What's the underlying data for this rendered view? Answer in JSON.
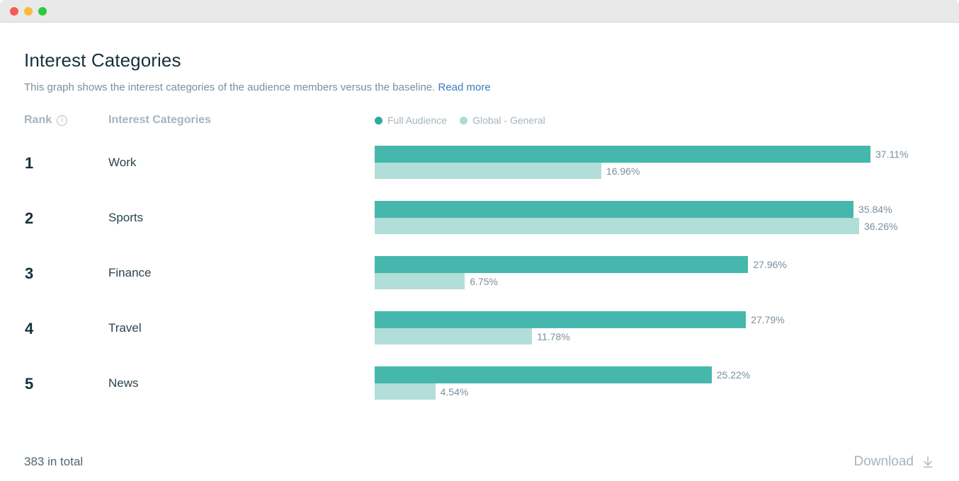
{
  "window": {
    "traffic_lights": [
      {
        "name": "close",
        "color": "#f85b53"
      },
      {
        "name": "minimize",
        "color": "#f7bb3f"
      },
      {
        "name": "maximize",
        "color": "#2ec93f"
      }
    ]
  },
  "header": {
    "title": "Interest Categories",
    "description": "This graph shows the interest categories of the audience members versus the baseline.",
    "read_more_label": "Read more"
  },
  "table_header": {
    "rank_label": "Rank",
    "rank_info_icon": "info-icon",
    "category_label": "Interest Categories"
  },
  "legend": {
    "items": [
      {
        "label": "Full Audience",
        "color": "#31a99e"
      },
      {
        "label": "Global - General",
        "color": "#a8dcd6"
      }
    ]
  },
  "footer": {
    "total_label": "383 in total",
    "download_label": "Download",
    "download_icon": "download-arrow-icon"
  },
  "colors": {
    "primary_bar": "#46b7ac",
    "secondary_bar": "#b2ded9",
    "title": "#16313d",
    "muted": "#7b8f9c",
    "link": "#3b7bbf"
  },
  "chart_data": {
    "type": "bar",
    "title": "Interest Categories",
    "subtitle": "This graph shows the interest categories of the audience members versus the baseline.",
    "orientation": "horizontal",
    "grid": false,
    "legend_position": "top-right",
    "xlabel": "",
    "ylabel": "",
    "xlim": [
      0,
      37.11
    ],
    "units": "percent",
    "max_value": 37.11,
    "categories": [
      "Work",
      "Sports",
      "Finance",
      "Travel",
      "News"
    ],
    "ranks": [
      1,
      2,
      3,
      4,
      5
    ],
    "series": [
      {
        "name": "Full Audience",
        "color": "#46b7ac",
        "values": [
          37.11,
          35.84,
          27.96,
          27.79,
          25.22
        ],
        "labels": [
          "37.11%",
          "35.84%",
          "27.96%",
          "27.79%",
          "25.22%"
        ]
      },
      {
        "name": "Global - General",
        "color": "#b2ded9",
        "values": [
          16.96,
          36.26,
          6.75,
          11.78,
          4.54
        ],
        "labels": [
          "16.96%",
          "36.26%",
          "6.75%",
          "11.78%",
          "4.54%"
        ]
      }
    ],
    "total_label": "383 in total"
  }
}
